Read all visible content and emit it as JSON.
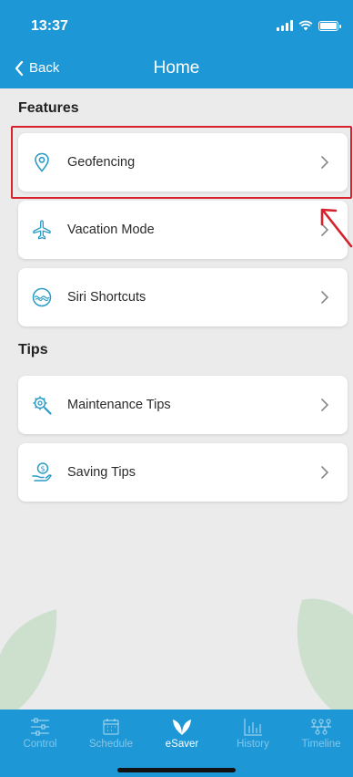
{
  "status": {
    "time": "13:37"
  },
  "header": {
    "back_label": "Back",
    "title": "Home"
  },
  "sections": {
    "features": {
      "title": "Features"
    },
    "tips": {
      "title": "Tips"
    }
  },
  "cards": [
    {
      "label": "Geofencing",
      "icon": "location-pin-icon"
    },
    {
      "label": "Vacation Mode",
      "icon": "airplane-icon"
    },
    {
      "label": "Siri Shortcuts",
      "icon": "siri-icon"
    },
    {
      "label": "Maintenance Tips",
      "icon": "gear-search-icon"
    },
    {
      "label": "Saving Tips",
      "icon": "hand-dollar-icon"
    }
  ],
  "tabs": [
    {
      "label": "Control",
      "icon": "sliders-icon",
      "active": false
    },
    {
      "label": "Schedule",
      "icon": "calendar-icon",
      "active": false
    },
    {
      "label": "eSaver",
      "icon": "leaf-icon",
      "active": true
    },
    {
      "label": "History",
      "icon": "bar-chart-icon",
      "active": false
    },
    {
      "label": "Timeline",
      "icon": "timeline-icon",
      "active": false
    }
  ],
  "colors": {
    "accent": "#1e97d6",
    "highlight": "#d7212c",
    "icon": "#2a9bc7"
  }
}
